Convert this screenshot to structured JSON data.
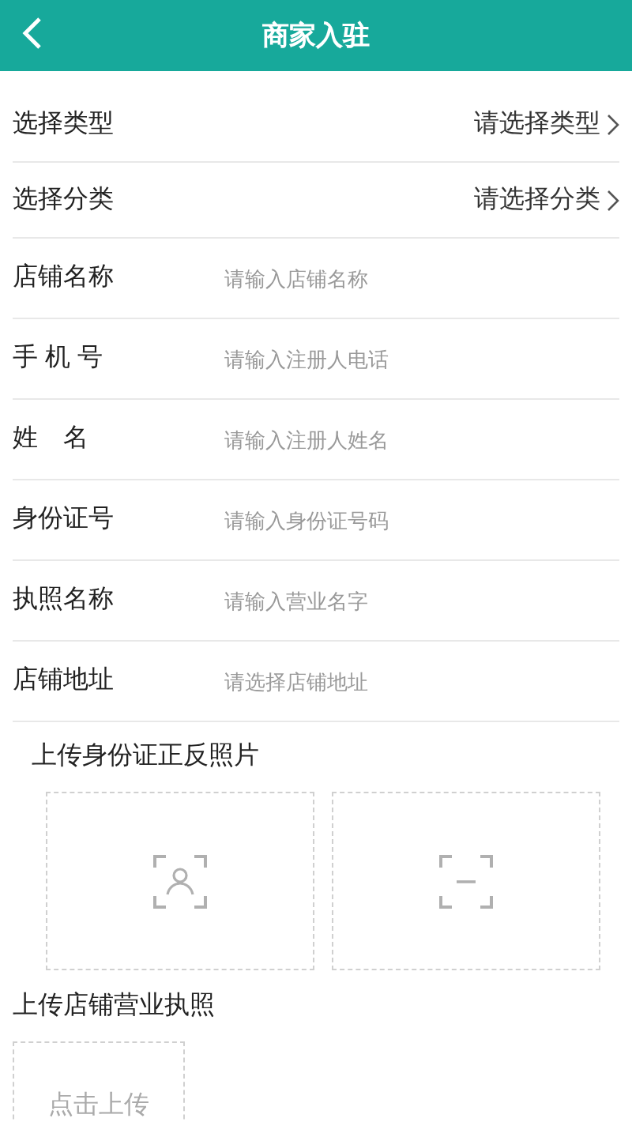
{
  "header": {
    "title": "商家入驻"
  },
  "fields": [
    {
      "kind": "select",
      "label": "选择类型",
      "value": "请选择类型"
    },
    {
      "kind": "select",
      "label": "选择分类",
      "value": "请选择分类"
    },
    {
      "kind": "input",
      "label": "店铺名称",
      "placeholder": "请输入店铺名称"
    },
    {
      "kind": "input",
      "label": "手 机 号",
      "placeholder": "请输入注册人电话"
    },
    {
      "kind": "input",
      "label": "姓　名",
      "placeholder": "请输入注册人姓名"
    },
    {
      "kind": "input",
      "label": "身份证号",
      "placeholder": "请输入身份证号码"
    },
    {
      "kind": "input",
      "label": "执照名称",
      "placeholder": "请输入营业名字"
    },
    {
      "kind": "input",
      "label": "店铺地址",
      "placeholder": "请选择店铺地址"
    }
  ],
  "id_upload": {
    "title": "上传身份证正反照片",
    "slots": [
      {
        "kind": "portrait"
      },
      {
        "kind": "back"
      }
    ]
  },
  "license_upload": {
    "title": "上传店铺营业执照",
    "button": "点击上传"
  }
}
